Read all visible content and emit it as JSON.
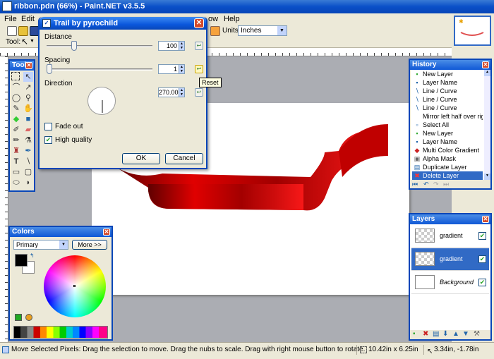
{
  "window": {
    "title": "ribbon.pdn (66%) - Paint.NET v3.5.5"
  },
  "menu": {
    "file": "File",
    "edit": "Edit",
    "window": "ow",
    "help": "Help"
  },
  "toolbar": {
    "tool_label": "Tool:",
    "units_label": "Units:",
    "units_value": "Inches"
  },
  "dialog": {
    "title": "Trail by pyrochild",
    "distance_label": "Distance",
    "distance_value": "100",
    "distance_fraction": 0.23,
    "spacing_label": "Spacing",
    "spacing_value": "1",
    "spacing_fraction": 0.0,
    "direction_label": "Direction",
    "direction_value": "270.00",
    "fade_out_label": "Fade out",
    "fade_out_checked": false,
    "high_quality_label": "High quality",
    "high_quality_checked": true,
    "ok_label": "OK",
    "cancel_label": "Cancel",
    "reset_tooltip": "Reset"
  },
  "tools": {
    "title": "Tools"
  },
  "colors": {
    "title": "Colors",
    "mode": "Primary",
    "more_button": "More >>"
  },
  "history": {
    "title": "History",
    "items": [
      "New Layer",
      "Layer Name",
      "Line / Curve",
      "Line / Curve",
      "Line / Curve",
      "Mirror left half over right ...",
      "Select All",
      "New Layer",
      "Layer Name",
      "Multi Color Gradient",
      "Alpha Mask",
      "Duplicate Layer",
      "Delete Layer"
    ]
  },
  "layers": {
    "title": "Layers",
    "items": [
      {
        "name": "gradient",
        "visible": true
      },
      {
        "name": "gradient",
        "visible": true
      },
      {
        "name": "Background",
        "visible": true
      }
    ]
  },
  "status": {
    "message": "Move Selected Pixels: Drag the selection to move. Drag the nubs to scale. Drag with right mouse button to rotate.",
    "size": "10.42in x 6.25in",
    "position": "3.34in, -1.78in"
  },
  "colors_accent": {
    "title_blue": "#0846b8",
    "ribbon_red": "#c00000",
    "selected": "#316ac5"
  }
}
